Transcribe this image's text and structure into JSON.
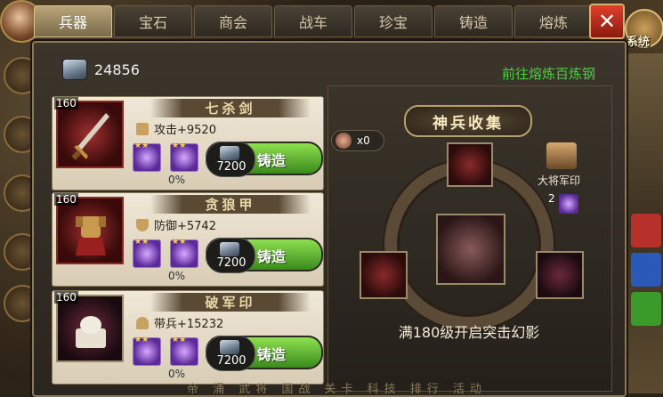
{
  "tabs": [
    {
      "label": "兵器",
      "active": true
    },
    {
      "label": "宝石",
      "active": false
    },
    {
      "label": "商会",
      "active": false
    },
    {
      "label": "战车",
      "active": false
    },
    {
      "label": "珍宝",
      "active": false
    },
    {
      "label": "铸造",
      "active": false
    },
    {
      "label": "熔炼",
      "active": false
    }
  ],
  "close_label": "✕",
  "system_label": "系统",
  "resource": {
    "icon": "iron-ingot-icon",
    "value": "24856"
  },
  "goto_link": "前往熔炼百炼钢",
  "items": [
    {
      "level": "160",
      "name": "七杀剑",
      "stat_icon": "sword-icon",
      "stat": "攻击+9520",
      "cost": "7200",
      "forge_label": "铸造",
      "progress": "0%",
      "progress_value": 0
    },
    {
      "level": "160",
      "name": "贪狼甲",
      "stat_icon": "shield-icon",
      "stat": "防御+5742",
      "cost": "7200",
      "forge_label": "铸造",
      "progress": "0%",
      "progress_value": 0
    },
    {
      "level": "160",
      "name": "破军印",
      "stat_icon": "helmet-icon",
      "stat": "带兵+15232",
      "cost": "7200",
      "forge_label": "铸造",
      "progress": "0%",
      "progress_value": 0
    }
  ],
  "collection": {
    "title": "神兵收集",
    "hammer_count": "x0",
    "seal_label": "大将军印",
    "seal_count": "2",
    "unlock_text": "满180级开启突击幻影"
  },
  "bottom_text": "帝 涌 武将 国战 关卡 科技 排行 活动",
  "colors": {
    "forge_green": "#5ac030",
    "goto_green": "#4ad040",
    "close_red": "#c82a1a"
  }
}
